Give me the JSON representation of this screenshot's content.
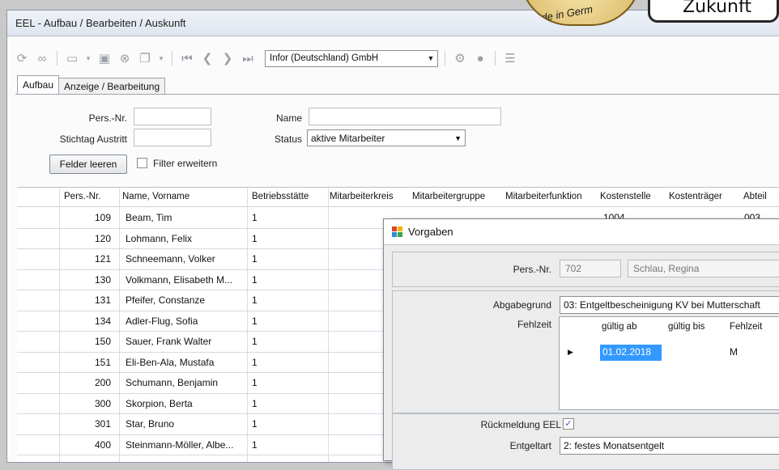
{
  "window": {
    "title": "EEL - Aufbau / Bearbeiten / Auskunft"
  },
  "toolbar": {
    "company": "Infor (Deutschland) GmbH"
  },
  "tabs": [
    "Aufbau",
    "Anzeige / Bearbeitung"
  ],
  "form": {
    "persnr_label": "Pers.-Nr.",
    "stichtag_label": "Stichtag Austritt",
    "name_label": "Name",
    "status_label": "Status",
    "status_value": "aktive Mitarbeiter",
    "clear_button": "Felder leeren",
    "filter_label": "Filter erweitern"
  },
  "grid": {
    "columns": [
      "Pers.-Nr.",
      "Name, Vorname",
      "Betriebsstätte",
      "Mitarbeiterkreis",
      "Mitarbeitergruppe",
      "Mitarbeiterfunktion",
      "Kostenstelle",
      "Kostenträger",
      "Abteil"
    ],
    "rows": [
      {
        "nr": "109",
        "name": "Beam, Tim",
        "bs": "1",
        "ks": "1004",
        "ab": "003"
      },
      {
        "nr": "120",
        "name": "Lohmann, Felix",
        "bs": "1",
        "ks": "",
        "ab": ""
      },
      {
        "nr": "121",
        "name": "Schneemann, Volker",
        "bs": "1",
        "ks": "",
        "ab": ""
      },
      {
        "nr": "130",
        "name": "Volkmann, Elisabeth M...",
        "bs": "1",
        "ks": "",
        "ab": ""
      },
      {
        "nr": "131",
        "name": "Pfeifer, Constanze",
        "bs": "1",
        "ks": "",
        "ab": ""
      },
      {
        "nr": "134",
        "name": "Adler-Flug, Sofia",
        "bs": "1",
        "ks": "",
        "ab": ""
      },
      {
        "nr": "150",
        "name": "Sauer, Frank Walter",
        "bs": "1",
        "ks": "",
        "ab": ""
      },
      {
        "nr": "151",
        "name": "Eli-Ben-Ala, Mustafa",
        "bs": "1",
        "ks": "",
        "ab": ""
      },
      {
        "nr": "200",
        "name": "Schumann, Benjamin",
        "bs": "1",
        "ks": "",
        "ab": ""
      },
      {
        "nr": "300",
        "name": "Skorpion, Berta",
        "bs": "1",
        "ks": "",
        "ab": ""
      },
      {
        "nr": "301",
        "name": "Star, Bruno",
        "bs": "1",
        "ks": "",
        "ab": ""
      },
      {
        "nr": "400",
        "name": "Steinmann-Möller, Albe...",
        "bs": "1",
        "ks": "",
        "ab": ""
      }
    ]
  },
  "dialog": {
    "title": "Vorgaben",
    "persnr_label": "Pers.-Nr.",
    "persnr_value": "702",
    "name_value": "Schlau, Regina",
    "abgabegrund_label": "Abgabegrund",
    "abgabegrund_value": "03: Entgeltbescheinigung KV bei Mutterschaft",
    "fehlzeit_label": "Fehlzeit",
    "fz_columns": [
      "gültig ab",
      "gültig bis",
      "Fehlzeit"
    ],
    "fz_row": {
      "ab": "01.02.2018",
      "bis": "",
      "fz": "M"
    },
    "rueckmeldung_label": "Rückmeldung EEL",
    "entgeltart_label": "Entgeltart",
    "entgeltart_value": "2: festes Monatsentgelt"
  },
  "overlay": {
    "badge_text": "de in Germ",
    "corner_text": "Zukunft"
  }
}
